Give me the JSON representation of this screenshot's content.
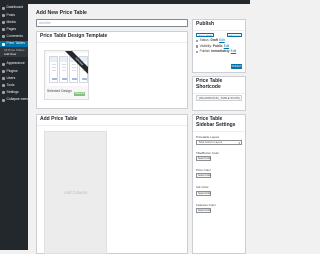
{
  "sidebar": {
    "items": [
      {
        "label": "Dashboard"
      },
      {
        "label": "Posts"
      },
      {
        "label": "Media"
      },
      {
        "label": "Pages"
      },
      {
        "label": "Comments"
      },
      {
        "label": "Price Tables"
      }
    ],
    "submenu": [
      "All Price Tables",
      "Add New"
    ],
    "items_bottom": [
      {
        "label": "Appearance"
      },
      {
        "label": "Plugins"
      },
      {
        "label": "Users"
      },
      {
        "label": "Tools"
      },
      {
        "label": "Settings"
      },
      {
        "label": "Collapse menu"
      }
    ]
  },
  "page": {
    "title": "Add New Price Table",
    "title_input_placeholder": "Add title"
  },
  "template_panel": {
    "title": "Price Table Design Template",
    "ribbon": "Selected",
    "caption": "Selected Design",
    "button": "Selected"
  },
  "add_panel": {
    "title": "Add Price Table",
    "add_column": "Add Column"
  },
  "publish": {
    "title": "Publish",
    "save_draft": "Save Draft",
    "preview": "Preview",
    "status_label": "Status:",
    "status_value": "Draft",
    "visibility_label": "Visibility:",
    "visibility_value": "Public",
    "publish_label": "Publish",
    "publish_value": "immediately",
    "edit_link": "Edit",
    "publish_button": "Publish"
  },
  "shortcode_panel": {
    "title": "Price Table Shortcode",
    "value": "[WLAPRICING_TABLE ID=65]"
  },
  "settings_panel": {
    "title": "Price Table Sidebar Settings",
    "fields": [
      {
        "label": "Pricetable Layout",
        "type": "select",
        "value": "Total Column Layout"
      },
      {
        "label": "Title/Button Color",
        "type": "color",
        "value": "Select Color"
      },
      {
        "label": "Price Color",
        "type": "color",
        "value": "Select Color"
      },
      {
        "label": "Attr Color",
        "type": "color",
        "value": "Select Color"
      },
      {
        "label": "Features Color",
        "type": "color",
        "value": "Select Color"
      }
    ]
  },
  "colors": {
    "admin_bar": "#23282d",
    "accent": "#0073aa",
    "selected_button": "#83c17f",
    "swatch": "#1e73be"
  }
}
